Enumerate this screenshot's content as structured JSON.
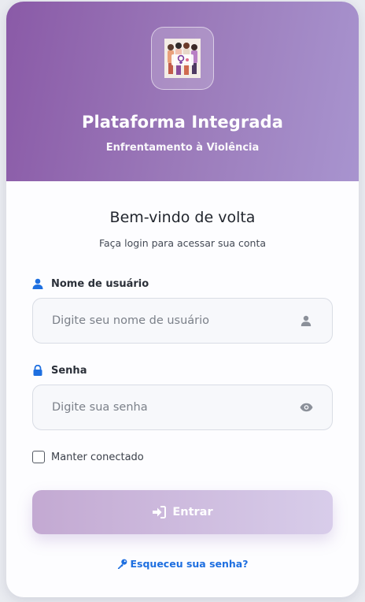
{
  "header": {
    "title": "Plataforma Integrada",
    "subtitle": "Enfrentamento à Violência",
    "logo_icon": "women-group-logo"
  },
  "welcome": {
    "heading": "Bem-vindo de volta",
    "subheading": "Faça login para acessar sua conta"
  },
  "form": {
    "username": {
      "label": "Nome de usuário",
      "placeholder": "Digite seu nome de usuário",
      "value": "",
      "icon": "user-icon"
    },
    "password": {
      "label": "Senha",
      "placeholder": "Digite sua senha",
      "value": "",
      "icon": "lock-icon",
      "toggle_icon": "eye-icon"
    },
    "remember_label": "Manter conectado",
    "remember_checked": false,
    "submit_label": "Entrar",
    "forgot_label": "Esqueceu sua senha?"
  },
  "colors": {
    "header_gradient_start": "#8a5aa7",
    "header_gradient_end": "#a894cf",
    "accent_blue": "#1e6fe0",
    "button_gradient_start": "#c3a9d2",
    "button_gradient_end": "#d8cdea"
  }
}
